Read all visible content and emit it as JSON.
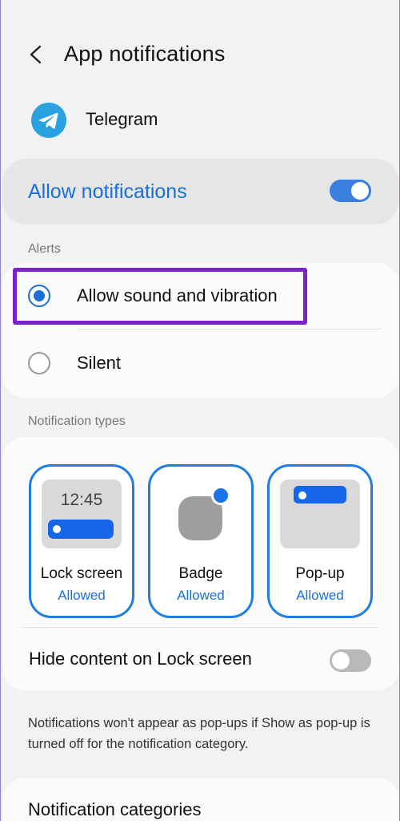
{
  "header": {
    "title": "App notifications",
    "back_icon": "back-arrow-icon"
  },
  "app": {
    "name": "Telegram",
    "icon": "telegram-icon",
    "icon_color": "#2AA1DF"
  },
  "allow_notifications": {
    "label": "Allow notifications",
    "enabled": true,
    "accent_color": "#1A6FD6"
  },
  "alerts": {
    "section_label": "Alerts",
    "options": [
      {
        "label": "Allow sound and vibration",
        "selected": true
      },
      {
        "label": "Silent",
        "selected": false
      }
    ],
    "highlight_color": "#7B22C9"
  },
  "notification_types": {
    "section_label": "Notification types",
    "tiles": [
      {
        "title": "Lock screen",
        "status": "Allowed",
        "preview_time": "12:45"
      },
      {
        "title": "Badge",
        "status": "Allowed"
      },
      {
        "title": "Pop-up",
        "status": "Allowed"
      }
    ],
    "hide_content": {
      "label": "Hide content on Lock screen",
      "enabled": false
    }
  },
  "footnote": "Notifications won't appear as pop-ups if Show as pop-up is turned off for the notification category.",
  "categories": {
    "label": "Notification categories"
  }
}
